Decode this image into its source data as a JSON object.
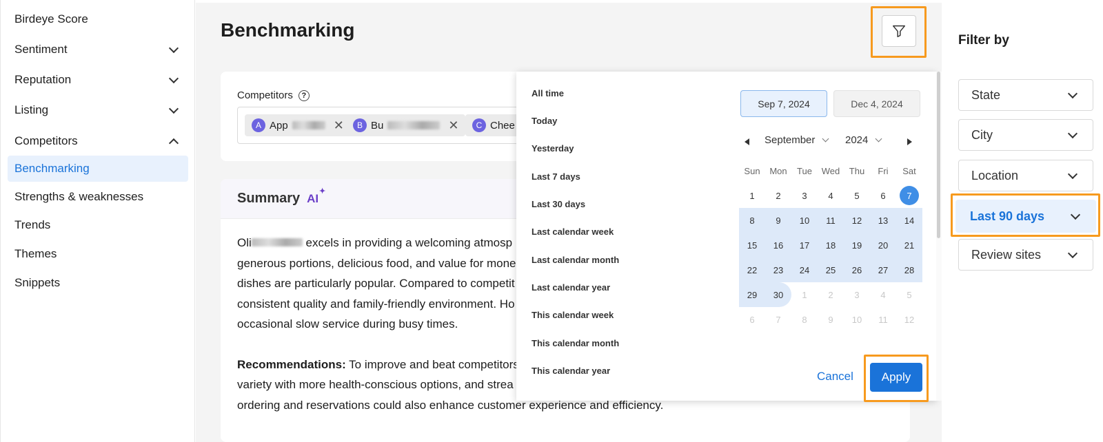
{
  "sidebar": {
    "items": [
      {
        "label": "Birdeye Score"
      },
      {
        "label": "Sentiment"
      },
      {
        "label": "Reputation"
      },
      {
        "label": "Listing"
      },
      {
        "label": "Competitors"
      },
      {
        "label": "Benchmarking"
      },
      {
        "label": "Strengths & weaknesses"
      },
      {
        "label": "Trends"
      },
      {
        "label": "Themes"
      },
      {
        "label": "Snippets"
      }
    ]
  },
  "main": {
    "title": "Benchmarking",
    "competitors": {
      "label": "Competitors",
      "help": "?",
      "chips": [
        {
          "initial": "A",
          "name": "App"
        },
        {
          "initial": "B",
          "name": "Bu"
        },
        {
          "initial": "C",
          "name": "Chee"
        }
      ]
    },
    "summary": {
      "title": "Summary",
      "ai": "AI",
      "p1_start": "Oli",
      "p1_rest": " excels in providing a welcoming atmosp",
      "lines": [
        "generous portions, delicious food, and value for mone",
        "dishes are particularly popular. Compared to competit",
        "consistent quality and family-friendly environment. Ho",
        "occasional slow service during busy times."
      ],
      "rec_label": "Recommendations:",
      "rec_line1": " To improve and beat competitors",
      "rec_lines": [
        "variety with more health-conscious options, and strea",
        "ordering and reservations could also enhance customer experience and efficiency."
      ]
    }
  },
  "date_picker": {
    "options": [
      "All time",
      "Today",
      "Yesterday",
      "Last 7 days",
      "Last 30 days",
      "Last calendar week",
      "Last calendar month",
      "Last calendar year",
      "This calendar week",
      "This calendar month",
      "This calendar year"
    ],
    "start_date": "Sep 7, 2024",
    "end_date": "Dec 4, 2024",
    "month": "September",
    "year": "2024",
    "weekdays": [
      "Sun",
      "Mon",
      "Tue",
      "Wed",
      "Thu",
      "Fri",
      "Sat"
    ],
    "weeks": [
      [
        "1",
        "2",
        "3",
        "4",
        "5",
        "6",
        "7"
      ],
      [
        "8",
        "9",
        "10",
        "11",
        "12",
        "13",
        "14"
      ],
      [
        "15",
        "16",
        "17",
        "18",
        "19",
        "20",
        "21"
      ],
      [
        "22",
        "23",
        "24",
        "25",
        "26",
        "27",
        "28"
      ],
      [
        "29",
        "30",
        "1",
        "2",
        "3",
        "4",
        "5"
      ],
      [
        "6",
        "7",
        "8",
        "9",
        "10",
        "11",
        "12"
      ]
    ],
    "selected_day": "7",
    "cancel_label": "Cancel",
    "apply_label": "Apply"
  },
  "filter_panel": {
    "title": "Filter by",
    "selects": [
      {
        "label": "State"
      },
      {
        "label": "City"
      },
      {
        "label": "Location"
      },
      {
        "label": "Last 90 days"
      },
      {
        "label": "Review sites"
      }
    ]
  },
  "colors": {
    "accent": "#1a73d9",
    "highlight": "#f79a1e",
    "range": "#dde9f9"
  }
}
